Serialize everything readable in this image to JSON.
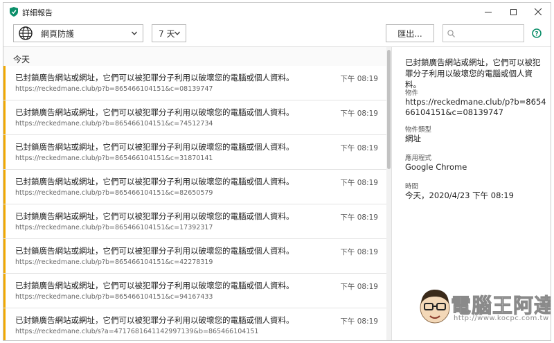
{
  "window": {
    "title": "詳細報告"
  },
  "toolbar": {
    "category_label": "網頁防護",
    "period_label": "7 天",
    "export_label": "匯出...",
    "search_placeholder": ""
  },
  "list": {
    "section_title": "今天",
    "items": [
      {
        "title": "已封鎖廣告網站或網址，它們可以被犯罪分子利用以破壞您的電腦或個人資料。",
        "url": "https://reckedmane.club/p?b=865466104151&c=08139747",
        "time": "下午 08:19"
      },
      {
        "title": "已封鎖廣告網站或網址，它們可以被犯罪分子利用以破壞您的電腦或個人資料。",
        "url": "https://reckedmane.club/p?b=865466104151&c=74512734",
        "time": "下午 08:19"
      },
      {
        "title": "已封鎖廣告網站或網址，它們可以被犯罪分子利用以破壞您的電腦或個人資料。",
        "url": "https://reckedmane.club/p?b=865466104151&c=31870141",
        "time": "下午 08:19"
      },
      {
        "title": "已封鎖廣告網站或網址，它們可以被犯罪分子利用以破壞您的電腦或個人資料。",
        "url": "https://reckedmane.club/p?b=865466104151&c=82650579",
        "time": "下午 08:19"
      },
      {
        "title": "已封鎖廣告網站或網址，它們可以被犯罪分子利用以破壞您的電腦或個人資料。",
        "url": "https://reckedmane.club/p?b=865466104151&c=17392317",
        "time": "下午 08:19"
      },
      {
        "title": "已封鎖廣告網站或網址，它們可以被犯罪分子利用以破壞您的電腦或個人資料。",
        "url": "https://reckedmane.club/p?b=865466104151&c=42278319",
        "time": "下午 08:19"
      },
      {
        "title": "已封鎖廣告網站或網址，它們可以被犯罪分子利用以破壞您的電腦或個人資料。",
        "url": "https://reckedmane.club/p?b=865466104151&c=94167433",
        "time": "下午 08:19"
      },
      {
        "title": "已封鎖廣告網站或網址，它們可以被犯罪分子利用以破壞您的電腦或個人資料。",
        "url": "https://reckedmane.club/s?a=4717681641142997139&b=865466104151",
        "time": "下午 08:19"
      }
    ]
  },
  "details": {
    "description": "已封鎖廣告網站或網址，它們可以被犯罪分子利用以破壞您的電腦或個人資料。",
    "object_label": "物件",
    "object_value": "https://reckedmane.club/p?b=865466104151&c=08139747",
    "object_type_label": "物件類型",
    "object_type_value": "網址",
    "application_label": "應用程式",
    "application_value": "Google Chrome",
    "time_label": "時間",
    "time_value": "今天，2020/4/23 下午 08:19"
  },
  "watermark": {
    "brand": "電腦王阿達",
    "url": "http://www.kocpc.com.tw"
  },
  "colors": {
    "accent": "#f2a900",
    "brand_green": "#0c8f6a"
  }
}
